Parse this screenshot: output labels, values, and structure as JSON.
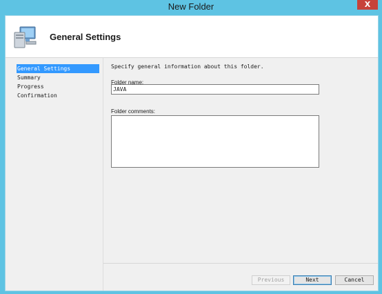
{
  "window": {
    "title": "New Folder",
    "close_label": "X"
  },
  "header": {
    "title": "General Settings",
    "icon": "computer-icon"
  },
  "sidebar": {
    "items": [
      {
        "label": "General Settings"
      },
      {
        "label": "Summary"
      },
      {
        "label": "Progress"
      },
      {
        "label": "Confirmation"
      }
    ]
  },
  "content": {
    "description": "Specify general information about this folder.",
    "folder_name_label": "Folder name:",
    "folder_name_value": "JAVA",
    "folder_comments_label": "Folder comments:",
    "folder_comments_value": ""
  },
  "footer": {
    "previous_label": "Previous",
    "next_label": "Next",
    "cancel_label": "Cancel"
  },
  "colors": {
    "accent": "#5ec3e3",
    "selection": "#3399ff",
    "close": "#c7423a"
  }
}
